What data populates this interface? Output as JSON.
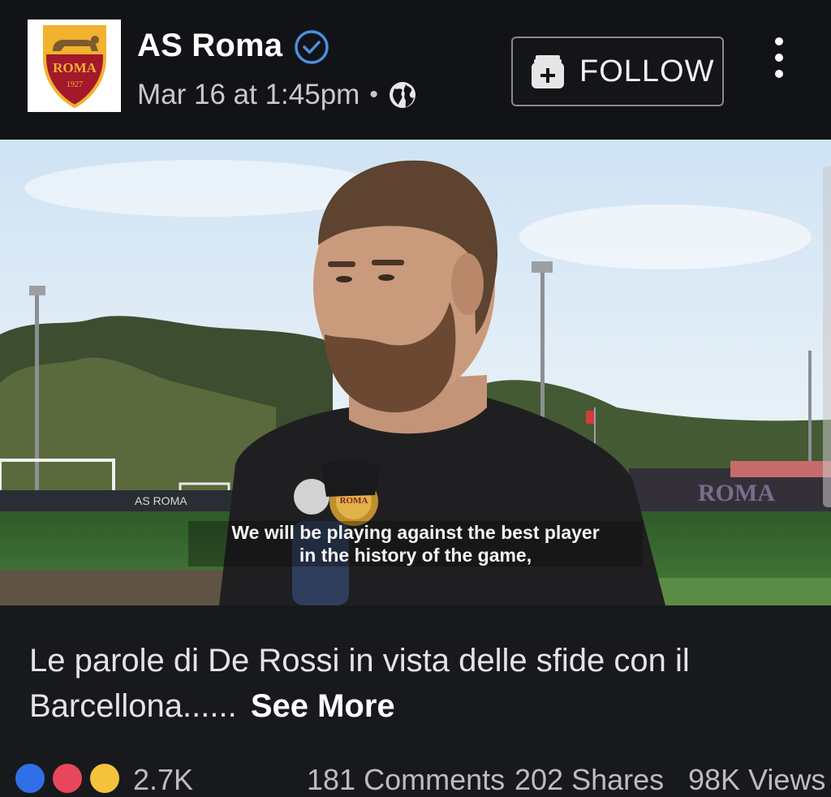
{
  "post": {
    "page_name": "AS Roma",
    "timestamp": "Mar 16 at 1:45pm",
    "separator": "•",
    "follow_label": "FOLLOW",
    "logo": {
      "text": "ROMA",
      "year": "1927"
    },
    "icons": {
      "verified": "verified-badge-icon",
      "audience": "globe-icon",
      "follow": "add-page-icon",
      "menu": "more-vertical-icon"
    }
  },
  "video": {
    "subtitle_line1": "We will be playing against the best player",
    "subtitle_line2": "in the history of the game,",
    "mic_label": "ROMA",
    "banner_left": "AS ROMA",
    "banner_right": "ROMA"
  },
  "caption": {
    "text": "Le parole di De Rossi in vista delle sfide con il Barcellona......",
    "see_more": "See More"
  },
  "stats": {
    "reactions_count": "2.7K",
    "comments": "181 Comments",
    "shares": "202 Shares",
    "views": "98K Views"
  },
  "colors": {
    "accent_blue": "#4a90e2",
    "header_bg": "#121316",
    "body_bg": "#18191d",
    "roma_red": "#a3182a",
    "roma_gold": "#f2b22e"
  }
}
